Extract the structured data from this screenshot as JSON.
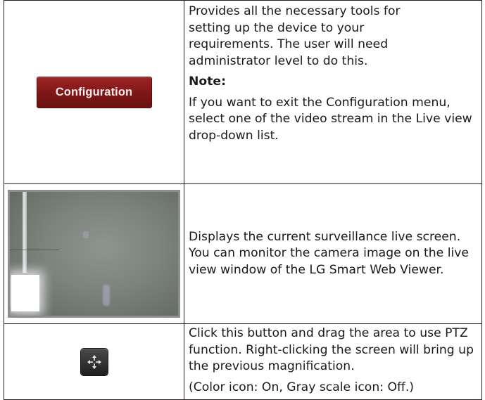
{
  "rows": [
    {
      "icon": "configuration-button",
      "button_label": "Configuration",
      "description": "Provides all the necessary tools for setting up the device to your requirements. The user will need administrator level to do this.",
      "note_label": "Note:",
      "note_text": "If you want to exit the Configuration menu, select one of the video stream in the Live view drop-down list."
    },
    {
      "icon": "live-view-image",
      "description": "Displays the current surveillance live screen. You can monitor the camera image on the live view window of the LG Smart Web Viewer."
    },
    {
      "icon": "ptz-move-icon",
      "description": "Click this button and drag the area to use PTZ function. Right-clicking the screen will bring up the previous magnification.",
      "extra": "(Color icon: On, Gray scale icon: Off.)"
    }
  ],
  "colors": {
    "config_button": "#7d1616",
    "ptz_button": "#2b2b2b",
    "border": "#231f20"
  }
}
